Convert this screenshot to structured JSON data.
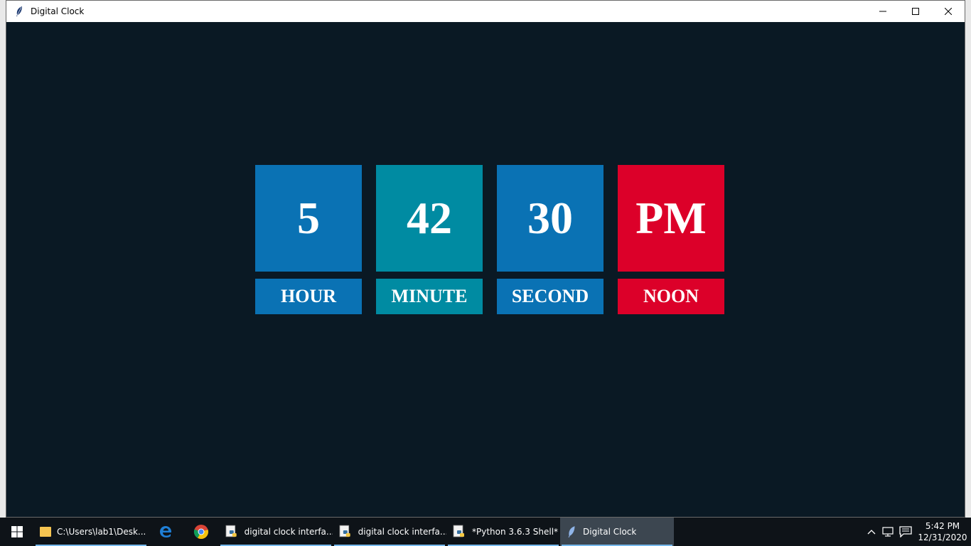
{
  "window": {
    "title": "Digital Clock"
  },
  "clock": {
    "hour": "5",
    "minute": "42",
    "second": "30",
    "period": "PM",
    "labels": {
      "hour": "HOUR",
      "minute": "MINUTE",
      "second": "SECOND",
      "period": "NOON"
    },
    "colors": {
      "hour": "#0a72b4",
      "minute": "#008ba2",
      "second": "#0a72b4",
      "period": "#dc0029",
      "background": "#0a1924"
    }
  },
  "taskbar": {
    "items": [
      {
        "label": "C:\\Users\\lab1\\Desk...",
        "icon": "folder-icon"
      },
      {
        "label": "",
        "icon": "edge-icon"
      },
      {
        "label": "",
        "icon": "chrome-icon"
      },
      {
        "label": "digital clock interfa...",
        "icon": "python-idle-icon"
      },
      {
        "label": "digital clock interfa...",
        "icon": "python-idle-icon"
      },
      {
        "label": "*Python 3.6.3 Shell*",
        "icon": "python-idle-icon"
      },
      {
        "label": "Digital Clock",
        "icon": "feather-icon"
      }
    ],
    "tray": {
      "time": "5:42 PM",
      "date": "12/31/2020"
    }
  }
}
